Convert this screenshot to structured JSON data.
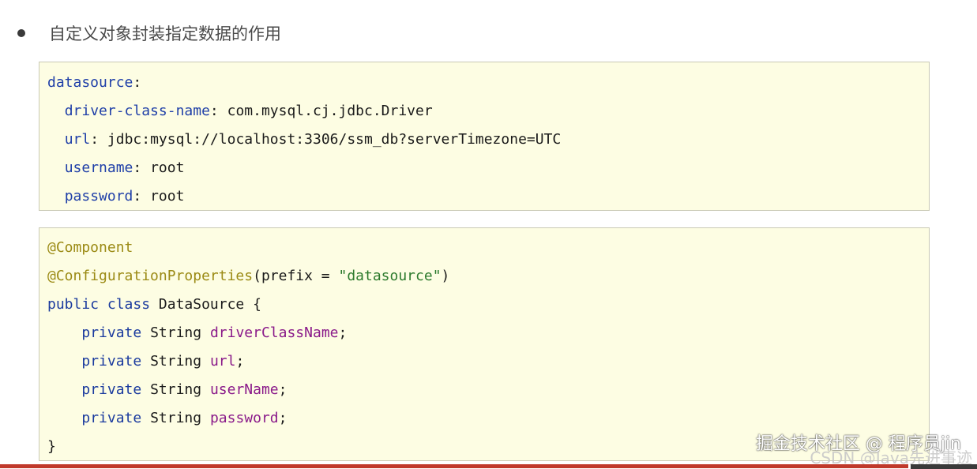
{
  "heading": {
    "text": "自定义对象封装指定数据的作用"
  },
  "yaml_block": {
    "root_key": "datasource",
    "entries": [
      {
        "key": "driver-class-name",
        "value": "com.mysql.cj.jdbc.Driver"
      },
      {
        "key": "url",
        "value": "jdbc:mysql://localhost:3306/ssm_db?serverTimezone=UTC"
      },
      {
        "key": "username",
        "value": "root"
      },
      {
        "key": "password",
        "value": "root"
      }
    ]
  },
  "java_block": {
    "annotation1": "@Component",
    "annotation2": "@ConfigurationProperties",
    "annotation2_arg_name": "prefix",
    "annotation2_arg_value": "\"datasource\"",
    "class_modifiers": "public class",
    "class_name": "DataSource",
    "fields": [
      {
        "modifier": "private",
        "type": "String",
        "name": "driverClassName"
      },
      {
        "modifier": "private",
        "type": "String",
        "name": "url"
      },
      {
        "modifier": "private",
        "type": "String",
        "name": "userName"
      },
      {
        "modifier": "private",
        "type": "String",
        "name": "password"
      }
    ],
    "closing": "}"
  },
  "watermarks": {
    "primary": "掘金技术社区 @ 程序员jin",
    "secondary": "CSDN @Java先进事迹"
  },
  "colors": {
    "code_background": "#fdfde3",
    "keyword": "#1a3a9e",
    "annotation": "#9b8a14",
    "string": "#2c7a2c",
    "field": "#8a1a8a",
    "accent_bar": "#c0392b"
  }
}
